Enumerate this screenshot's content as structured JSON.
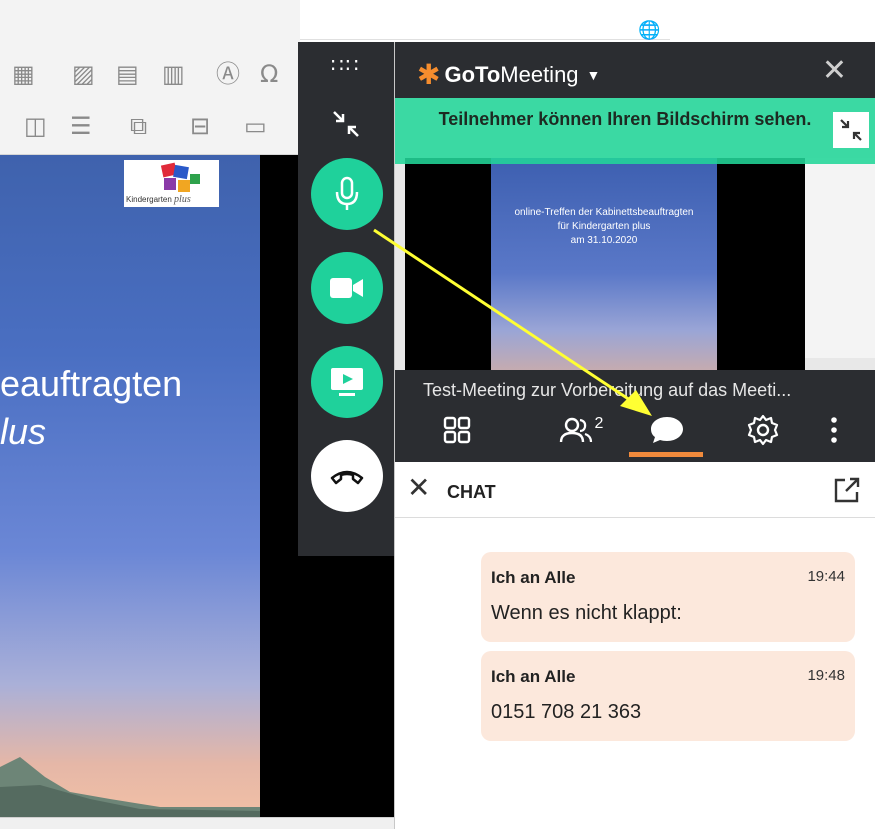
{
  "slide": {
    "title_line1": "eauftragten",
    "title_line2": "lus",
    "logo_label": "Kindergarten",
    "logo_label_italic": "plus"
  },
  "icons": {
    "background_ribbon": [
      "table-icon",
      "picture-icon",
      "video-icon",
      "chart-icon",
      "wordart-icon",
      "omega-icon",
      "align-icon",
      "group-icon",
      "crop-icon",
      "globe-icon"
    ],
    "controls": [
      "drag-handle-icon",
      "shrink-icon",
      "microphone-icon",
      "camera-icon",
      "screen-share-icon",
      "hang-up-icon"
    ],
    "tabs": [
      "grid-icon",
      "people-icon",
      "chat-bubble-icon",
      "gear-icon",
      "more-vertical-icon"
    ]
  },
  "panel": {
    "brand_bold": "GoTo",
    "brand_light": "Meeting",
    "banner_text": "Teilnehmer können Ihren Bildschirm sehen.",
    "preview_slide_line1": "online-Treffen der Kabinettsbeauftragten",
    "preview_slide_line2": "für Kindergarten plus",
    "preview_slide_line3": "am 31.10.2020",
    "meeting_title": "Test-Meeting zur Vorbereitung auf das Meeti...",
    "attendee_count": "2",
    "active_tab": "chat"
  },
  "chat": {
    "title": "CHAT",
    "messages": [
      {
        "sender": "Ich an Alle",
        "time": "19:44",
        "text": "Wenn es nicht klappt:"
      },
      {
        "sender": "Ich an Alle",
        "time": "19:48",
        "text": "0151 708 21 363"
      }
    ]
  },
  "colors": {
    "brand_orange": "#f68d2e",
    "control_green": "#1fd19b",
    "dark_bar": "#2b2d31",
    "banner_green": "#22d699",
    "chat_bubble": "#fce8dc",
    "annotation_arrow": "#ffff33"
  }
}
